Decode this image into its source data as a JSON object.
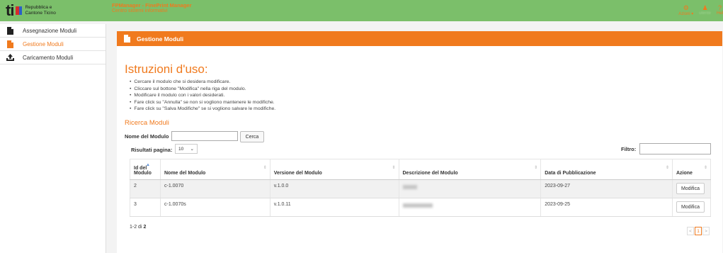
{
  "header": {
    "logo_text": "ti",
    "org_name": "Repubblica e Cantone Ticino",
    "app_title": "FPManager - FinePrint Manager",
    "app_subtitle": "Centro sistemi informativi",
    "icons": [
      {
        "icon": "gear-icon",
        "label": "Azioni ▾"
      },
      {
        "icon": "user-icon",
        "label": "utente"
      },
      {
        "icon": "help-icon",
        "label": "Hel"
      }
    ],
    "colors": {
      "bar": "#7bbf6a",
      "accent": "#f07a1e"
    }
  },
  "sidebar": {
    "items": [
      {
        "icon": "file-icon",
        "label": "Assegnazione Moduli",
        "active": false
      },
      {
        "icon": "file-icon",
        "label": "Gestione Moduli",
        "active": true
      },
      {
        "icon": "upload-icon",
        "label": "Caricamento Moduli",
        "active": false
      }
    ]
  },
  "panel": {
    "title": "Gestione Moduli",
    "instructions_title": "Istruzioni d'uso:",
    "instructions": [
      "Cercare il modulo che si desidera modificare.",
      "Cliccare sul bottone \"Modifica\" nella riga del modulo.",
      "Modificare il modulo con i valori desiderati.",
      "Fare click su \"Annulla\" se non si vogliono mantenere le modifiche.",
      "Fare click su \"Salva Modifiche\" se si vogliono salvare le modifiche."
    ],
    "search_title": "Ricerca Moduli",
    "name_label": "Nome del Modulo",
    "name_value": "",
    "search_button": "Cerca",
    "results_label": "Risultati pagina:",
    "results_value": "10",
    "filter_label": "Filtro:",
    "filter_value": ""
  },
  "table": {
    "headers": [
      "Id del Modulo",
      "Nome del Modulo",
      "Versione del Modulo",
      "Descrizione del Modulo",
      "Data di Pubblicazione",
      "Azione"
    ],
    "rows": [
      {
        "id": "2",
        "name": "c-1.0070",
        "version": "v.1.0.0",
        "date": "2023-09-27",
        "action": "Modifica"
      },
      {
        "id": "3",
        "name": "c-1.0070s",
        "version": "v.1.0.11",
        "date": "2023-09-25",
        "action": "Modifica"
      }
    ]
  },
  "pagination": {
    "range": "1-2 di",
    "total": "2",
    "prev": "<",
    "current": "1",
    "next": ">"
  }
}
